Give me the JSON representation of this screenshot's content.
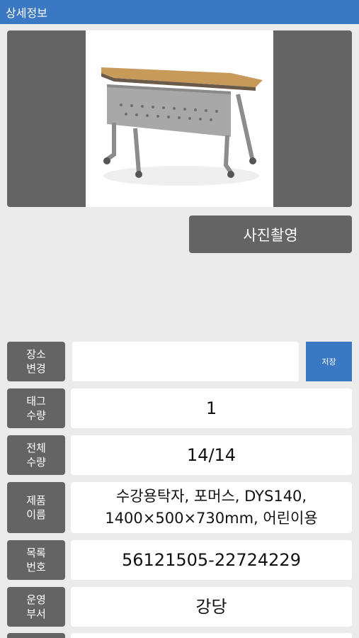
{
  "header": {
    "title": "상세정보"
  },
  "photo": {
    "capture_label": "사진촬영"
  },
  "location": {
    "label": "장소\n변경",
    "input_value": "",
    "save_label": "저장"
  },
  "details": [
    {
      "label": "태그\n수량",
      "value": "1"
    },
    {
      "label": "전체\n수량",
      "value": "14/14"
    },
    {
      "label": "제품\n이름",
      "value": "수강용탁자, 포머스, DYS140, 1400×500×730mm, 어린이용"
    },
    {
      "label": "목록\n번호",
      "value": "56121505-22724229"
    },
    {
      "label": "운영\n부서",
      "value": "강당"
    }
  ],
  "colors": {
    "accent": "#3a78c3",
    "label_bg": "#646464",
    "page_bg": "#ebebeb"
  }
}
